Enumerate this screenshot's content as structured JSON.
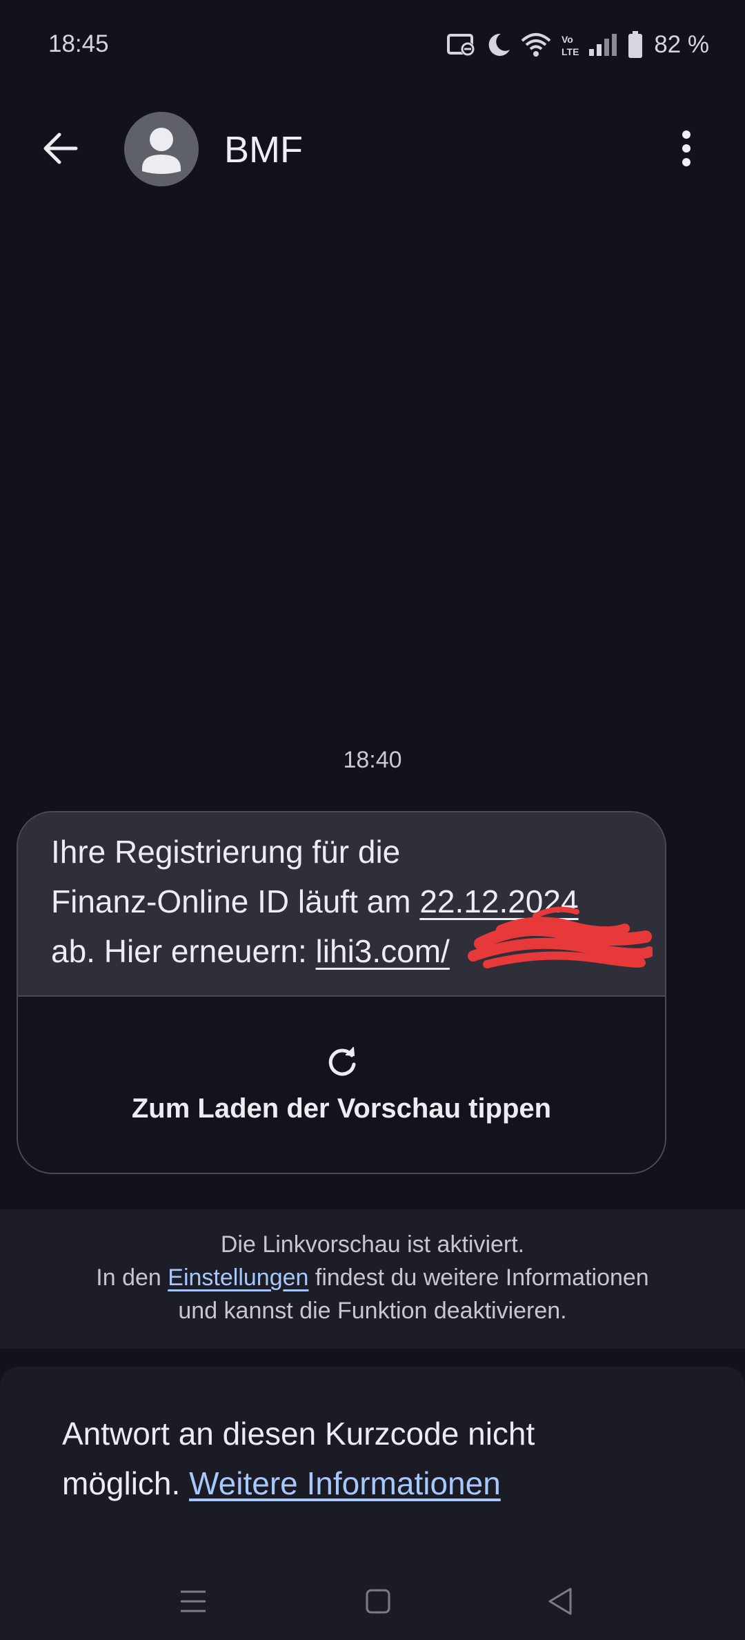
{
  "status_bar": {
    "time": "18:45",
    "battery_percent": "82 %",
    "icons": [
      "screen-record-icon",
      "moon-icon",
      "wifi-icon",
      "volte-icon",
      "signal-icon",
      "battery-icon"
    ]
  },
  "header": {
    "contact_name": "BMF",
    "back_icon": "arrow-back-icon",
    "menu_icon": "more-vert-icon"
  },
  "conversation": {
    "timestamp": "18:40",
    "message": {
      "line1": "Ihre Registrierung für die",
      "line2_prefix": "Finanz-Online ID läuft am ",
      "line2_date": "22.12.2024",
      "line3_prefix": "ab. Hier erneuern: ",
      "line3_link": "lihi3.com/"
    },
    "preview": {
      "icon": "refresh-icon",
      "label": "Zum Laden der Vorschau tippen"
    }
  },
  "link_preview_info": {
    "line1": "Die Linkvorschau ist aktiviert.",
    "line2_prefix": "In den ",
    "line2_link": "Einstellungen",
    "line2_suffix": " findest du weitere Informationen",
    "line3": "und kannst die Funktion deaktivieren."
  },
  "reply_notice": {
    "line1": "Antwort an diesen Kurzcode nicht",
    "line2_prefix": "möglich. ",
    "line2_link": "Weitere Informationen"
  },
  "nav": {
    "icons": [
      "recents-icon",
      "home-icon",
      "back-triangle-icon"
    ]
  },
  "colors": {
    "background": "#12121c",
    "bubble": "#2f2f3a",
    "link": "#a8c7fa",
    "redaction": "#e8393a"
  }
}
